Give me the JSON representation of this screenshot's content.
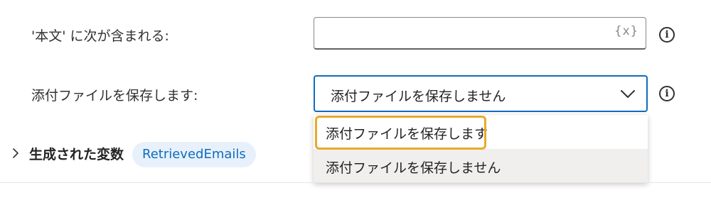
{
  "fields": {
    "body_contains": {
      "label": "'本文' に次が含まれる:",
      "value": "",
      "variable_glyph": "{x}",
      "info_icon": "info-circle-icon"
    },
    "save_attachments": {
      "label": "添付ファイルを保存します:",
      "selected_value": "添付ファイルを保存しません",
      "info_icon": "info-circle-icon",
      "options": [
        "添付ファイルを保存します",
        "添付ファイルを保存しません"
      ]
    }
  },
  "generated_variables": {
    "title": "生成された変数",
    "variables": [
      "RetrievedEmails"
    ]
  },
  "colors": {
    "accent": "#0f6cbd",
    "focus_highlight": "#e8a92b",
    "pill_background": "#e8f1fb",
    "hover_background": "#f0efed"
  }
}
